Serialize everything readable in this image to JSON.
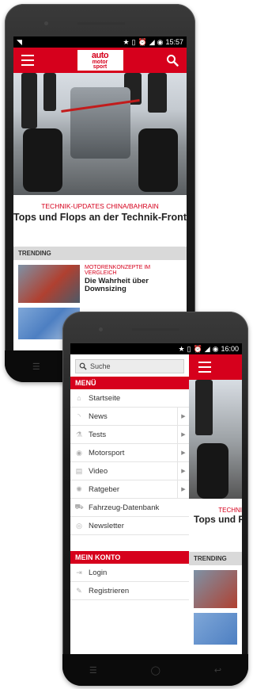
{
  "phone1": {
    "status": {
      "time": "15:57"
    },
    "logo": {
      "line1": "auto",
      "line2": "motor",
      "line3": "sport"
    },
    "article": {
      "kicker": "TECHNIK-UPDATES CHINA/BAHRAIN",
      "headline": "Tops und Flops an der Technik-Front"
    },
    "trending": {
      "label": "TRENDING",
      "items": [
        {
          "kicker": "MOTORENKONZEPTE IM VERGLEICH",
          "headline": "Die Wahrheit über Downsizing"
        }
      ]
    }
  },
  "phone2": {
    "status": {
      "time": "16:00"
    },
    "search": {
      "placeholder": "Suche"
    },
    "menu_label": "MENÜ",
    "menu_items": [
      {
        "label": "Startseite",
        "icon": "home-icon",
        "submenu": false
      },
      {
        "label": "News",
        "icon": "rss-icon",
        "submenu": true
      },
      {
        "label": "Tests",
        "icon": "flask-icon",
        "submenu": true
      },
      {
        "label": "Motorsport",
        "icon": "helmet-icon",
        "submenu": true
      },
      {
        "label": "Video",
        "icon": "film-icon",
        "submenu": true
      },
      {
        "label": "Ratgeber",
        "icon": "tips-icon",
        "submenu": true
      },
      {
        "label": "Fahrzeug-Datenbank",
        "icon": "car-icon",
        "submenu": false
      },
      {
        "label": "Newsletter",
        "icon": "mail-icon",
        "submenu": false
      }
    ],
    "account_label": "MEIN KONTO",
    "account_items": [
      {
        "label": "Login",
        "icon": "login-icon"
      },
      {
        "label": "Registrieren",
        "icon": "edit-icon"
      }
    ],
    "behind": {
      "kicker": "TECHNI",
      "headline": "Tops und F",
      "trending": "TRENDING"
    }
  },
  "colors": {
    "brand_red": "#d6001c"
  }
}
